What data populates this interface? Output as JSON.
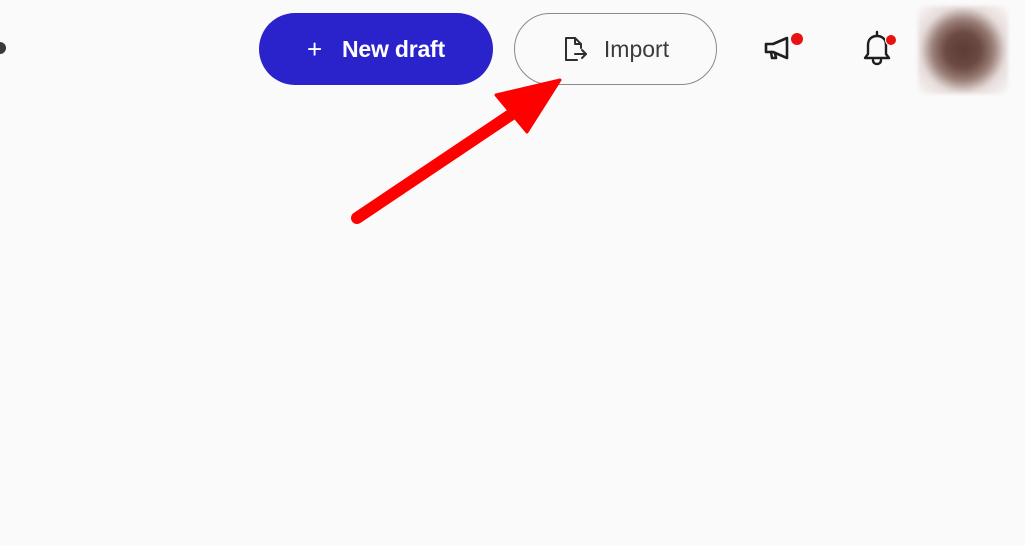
{
  "header": {
    "new_draft": {
      "icon": "plus-icon",
      "icon_glyph": "+",
      "label": "New draft",
      "background": "#2a22cb"
    },
    "import": {
      "icon": "file-export-icon",
      "label": "Import"
    },
    "announcements": {
      "icon": "megaphone-icon",
      "has_badge": true
    },
    "notifications": {
      "icon": "bell-icon",
      "has_badge": true
    },
    "avatar": {
      "icon": "avatar"
    }
  },
  "annotation": {
    "type": "arrow",
    "color": "#ff0000",
    "points_to": "import-button"
  }
}
